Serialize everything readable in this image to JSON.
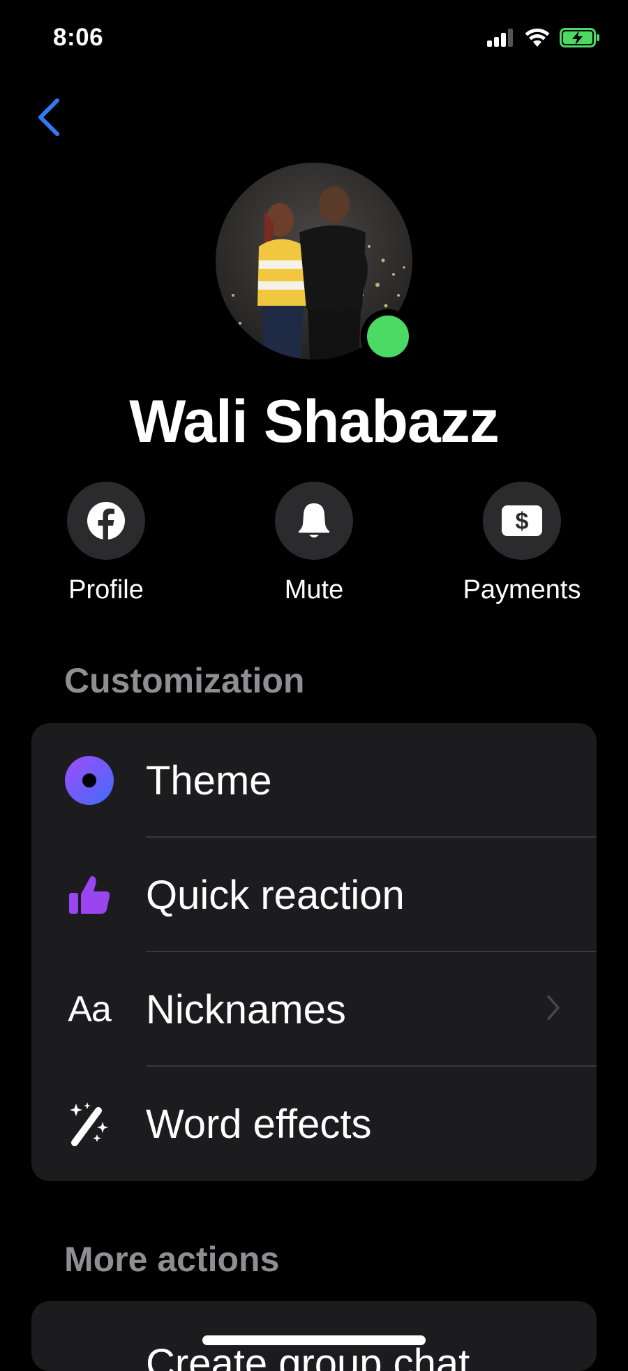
{
  "status_bar": {
    "time": "8:06"
  },
  "contact": {
    "name": "Wali Shabazz",
    "online": true
  },
  "quick_actions": [
    {
      "label": "Profile",
      "icon": "facebook-icon"
    },
    {
      "label": "Mute",
      "icon": "bell-icon"
    },
    {
      "label": "Payments",
      "icon": "dollar-icon"
    }
  ],
  "customization": {
    "heading": "Customization",
    "items": [
      {
        "label": "Theme",
        "icon": "theme-icon"
      },
      {
        "label": "Quick reaction",
        "icon": "thumbs-up-icon"
      },
      {
        "label": "Nicknames",
        "icon": "nicknames-icon",
        "icon_text": "Aa"
      },
      {
        "label": "Word effects",
        "icon": "sparkle-wand-icon"
      }
    ]
  },
  "more_actions": {
    "heading": "More actions",
    "items": [
      {
        "label": "Create group chat"
      }
    ]
  },
  "colors": {
    "accent": "#3478f6",
    "online": "#4cd964",
    "theme_gradient_start": "#a04dfb",
    "theme_gradient_end": "#3f6cf7",
    "quick_reaction": "#9b45f0"
  }
}
